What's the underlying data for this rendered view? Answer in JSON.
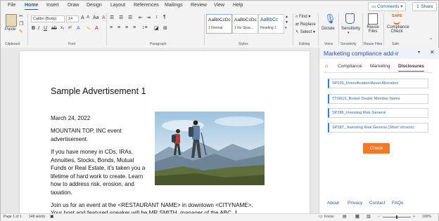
{
  "menu": {
    "tabs": [
      "File",
      "Home",
      "Insert",
      "Draw",
      "Design",
      "Layout",
      "References",
      "Mailings",
      "Review",
      "View",
      "Help"
    ],
    "active": "Home",
    "comments_label": "Comments",
    "share_label": "Share"
  },
  "ribbon": {
    "paste_label": "Paste",
    "font_name": "Calibri (Body)",
    "font_size": "14",
    "styles": [
      {
        "sample": "AaBbCcDc",
        "name": "1 Normal"
      },
      {
        "sample": "AaBbCcDc",
        "name": "1 No Spac..."
      },
      {
        "sample": "AaBbCc",
        "name": "Heading 1"
      }
    ],
    "find_label": "Find",
    "replace_label": "Replace",
    "select_label": "Select",
    "dictate_label": "Dictate",
    "sensitivity_label": "Sensitivity",
    "reuse_label": "Reuse Files",
    "compliance_label": "Compliance Check",
    "safe_label": "SAFE",
    "group_labels": {
      "clipboard": "Clipboard",
      "font": "Font",
      "paragraph": "Paragraph",
      "styles": "Styles",
      "editing": "Editing",
      "voice": "Voice",
      "sensitivity": "Sensitivity",
      "reuse": "Reuse Files",
      "safe": "Safe"
    }
  },
  "document": {
    "title": "Sample Advertisement 1",
    "date": "March 24, 2022",
    "event_line1": "MOUNTAIN TOP, INC event",
    "event_line2": "advertisement.",
    "body1": [
      "If you have money in CDs, IRAs,",
      "Annuities, Stocks, Bonds, Mutual",
      "Funds or Real Estate, it’s taken you a",
      "lifetime of hard work to create.  Learn",
      "how to address risk, erosion, and",
      "taxation."
    ],
    "body2_line1": "Join us for an event at the <RESTAURANT NAME> in downtown <CITYNAME>.",
    "body2_line2": "Your host and featured speaker will be MR SMITH, manager of the ABC"
  },
  "pane": {
    "title": "Marketing compliance add-ir",
    "tabs": [
      "Compliance",
      "Marketing",
      "Disclosures"
    ],
    "active_tab": "Disclosures",
    "disclosures": [
      "SP015_Dversification/Asset Allocation",
      "TTG015_Broker Dealer Member Name",
      "SP286_Investing Risk General",
      "SP287_ Investing Risk General (Short Version)"
    ],
    "check_label": "Check",
    "footer_links": [
      "About",
      "Privacy",
      "Contact",
      "FAQs"
    ]
  },
  "status": {
    "page": "Page 1 of 1",
    "words": "148 words",
    "focus": "Focus",
    "zoom": "100%"
  },
  "colors": {
    "accent": "#2b5797",
    "check_button": "#f07a2a",
    "disclosure_border": "#2a7fd4"
  }
}
